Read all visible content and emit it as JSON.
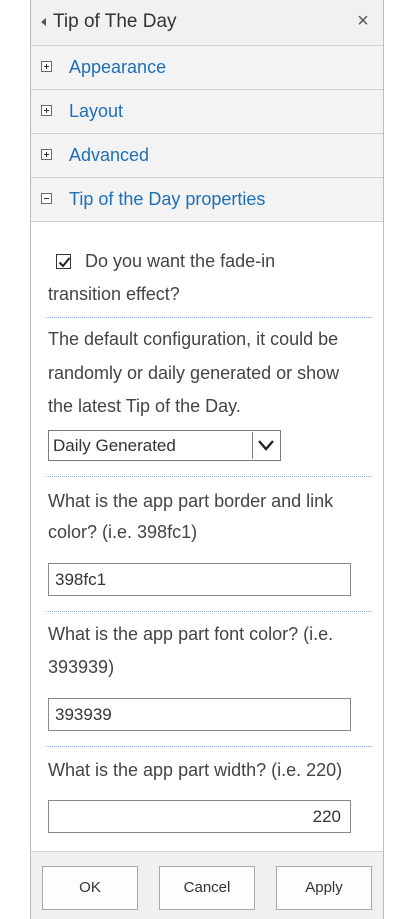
{
  "panel": {
    "title": "Tip of The Day",
    "close_glyph": "×"
  },
  "sections": [
    {
      "label": "Appearance",
      "expanded": false
    },
    {
      "label": "Layout",
      "expanded": false
    },
    {
      "label": "Advanced",
      "expanded": false
    },
    {
      "label": "Tip of the Day properties",
      "expanded": true
    }
  ],
  "properties": {
    "fade_checkbox_checked": true,
    "fade_line1": "Do you want the fade-in",
    "fade_line2": "transition effect?",
    "default_config_lines": [
      "The default configuration, it could be",
      "randomly or daily generated or show",
      "the latest Tip of the Day."
    ],
    "mode_select_value": "Daily Generated",
    "border_color_lines": [
      "What is the app part border and link",
      "color? (i.e. 398fc1)"
    ],
    "border_color_value": "398fc1",
    "font_color_lines": [
      "What is the app part font color? (i.e.",
      "393939)"
    ],
    "font_color_value": "393939",
    "width_label": "What is the app part width? (i.e. 220)",
    "width_value": "220"
  },
  "footer": {
    "ok_label": "OK",
    "cancel_label": "Cancel",
    "apply_label": "Apply"
  },
  "colors": {
    "link": "#1f6fb5",
    "text": "#444444",
    "header_bg": "#f1f1f1",
    "separator": "#8aa4d0"
  },
  "icons": {
    "collapse": "chevron-left-icon",
    "close": "close-icon",
    "expand": "plus-box-icon",
    "collapse_section": "minus-box-icon",
    "check": "checkmark-icon",
    "dropdown": "chevron-down-icon"
  }
}
